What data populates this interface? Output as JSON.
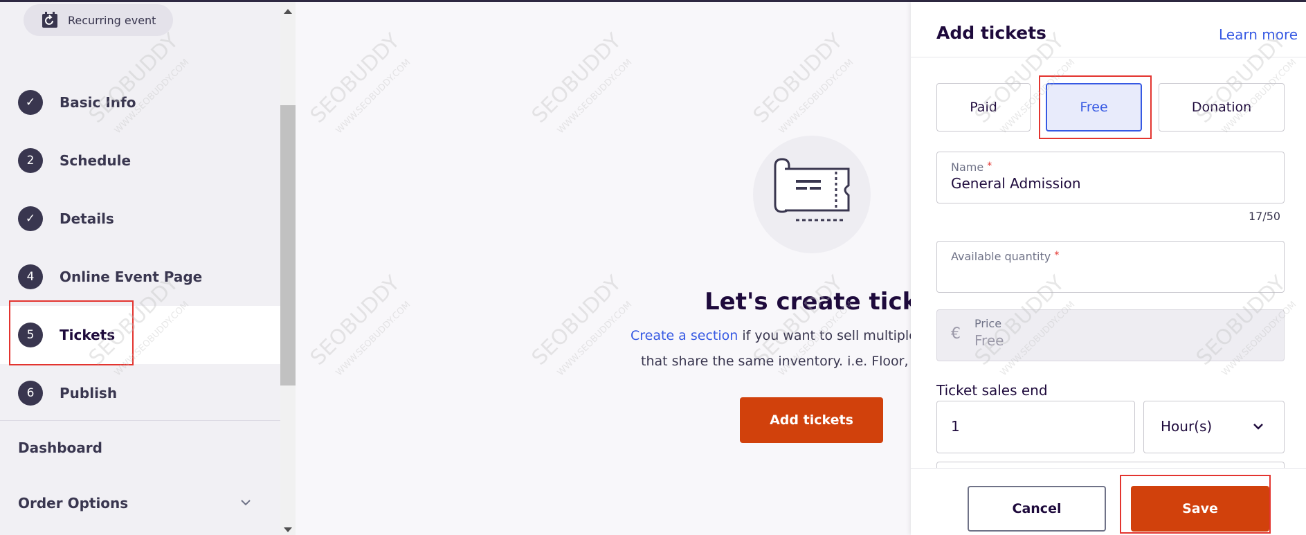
{
  "sidebar": {
    "recurring_label": "Recurring event",
    "steps": [
      {
        "marker": "✓",
        "label": "Basic Info"
      },
      {
        "marker": "2",
        "label": "Schedule"
      },
      {
        "marker": "✓",
        "label": "Details"
      },
      {
        "marker": "4",
        "label": "Online Event Page"
      },
      {
        "marker": "5",
        "label": "Tickets"
      },
      {
        "marker": "6",
        "label": "Publish"
      }
    ],
    "active_step": "Tickets",
    "dashboard_label": "Dashboard",
    "order_options_label": "Order Options"
  },
  "main": {
    "title": "Let's create tickets",
    "desc_link": "Create a section",
    "desc_rest": " if you want to sell multiple",
    "desc_line2": "that share the same inventory. i.e. Floor, M",
    "add_button_label": "Add tickets"
  },
  "panel": {
    "title": "Add tickets",
    "learn_more": "Learn more",
    "ticket_types": [
      "Paid",
      "Free",
      "Donation"
    ],
    "selected_type": "Free",
    "name_label": "Name",
    "name_value": "General Admission",
    "name_counter": "17/50",
    "quantity_label": "Available quantity",
    "quantity_value": "",
    "price_currency": "€",
    "price_label": "Price",
    "price_value": "Free",
    "sales_end_label": "Ticket sales end",
    "sales_end_value": "1",
    "sales_end_unit": "Hour(s)",
    "cancel_label": "Cancel",
    "save_label": "Save"
  },
  "watermark": {
    "text": "SEOBUDDY",
    "url": "WWW.SEOBUDDY.COM"
  },
  "colors": {
    "accent": "#d1410c",
    "link": "#3659e3",
    "highlight": "#e3342f",
    "step_dot": "#39364f"
  }
}
